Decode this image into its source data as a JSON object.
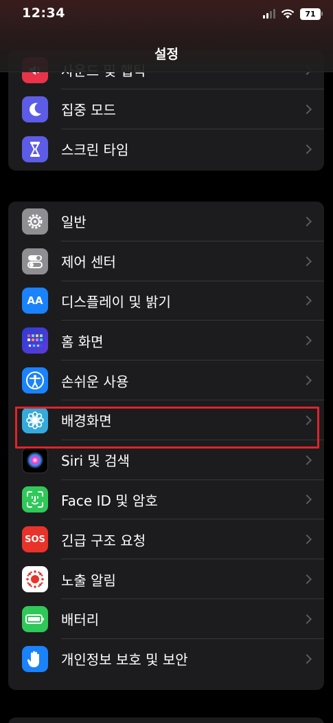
{
  "status_bar": {
    "time": "12:34",
    "battery": "71"
  },
  "nav": {
    "title": "설정"
  },
  "group1": [
    {
      "label": "사운드 및 햅틱",
      "icon": "speaker-icon",
      "color": "#e8334a"
    },
    {
      "label": "집중 모드",
      "icon": "moon-icon",
      "color": "#5d5ce6"
    },
    {
      "label": "스크린 타임",
      "icon": "hourglass-icon",
      "color": "#5d5ce6"
    }
  ],
  "group2": [
    {
      "label": "일반",
      "icon": "gear-icon",
      "color": "#8e8e93"
    },
    {
      "label": "제어 센터",
      "icon": "toggles-icon",
      "color": "#8e8e93"
    },
    {
      "label": "디스플레이 및 밝기",
      "icon": "aa-icon",
      "color": "#1a82fb"
    },
    {
      "label": "홈 화면",
      "icon": "home-grid-icon",
      "color": "#2c3ed6"
    },
    {
      "label": "손쉬운 사용",
      "icon": "accessibility-icon",
      "color": "#1a82fb"
    },
    {
      "label": "배경화면",
      "icon": "wallpaper-flower-icon",
      "color": "#35aadc"
    },
    {
      "label": "Siri 및 검색",
      "icon": "siri-icon",
      "color": "#000000"
    },
    {
      "label": "Face ID 및 암호",
      "icon": "faceid-icon",
      "color": "#30c859"
    },
    {
      "label": "긴급 구조 요청",
      "icon": "sos-icon",
      "color": "#e8332a"
    },
    {
      "label": "노출 알림",
      "icon": "exposure-icon",
      "color": "#ffffff"
    },
    {
      "label": "배터리",
      "icon": "battery-icon",
      "color": "#30c859"
    },
    {
      "label": "개인정보 보호 및 보안",
      "icon": "hand-icon",
      "color": "#1a82fb"
    }
  ],
  "icon_text": {
    "aa": "AA",
    "sos": "SOS"
  },
  "highlight_color": "#e0232b"
}
